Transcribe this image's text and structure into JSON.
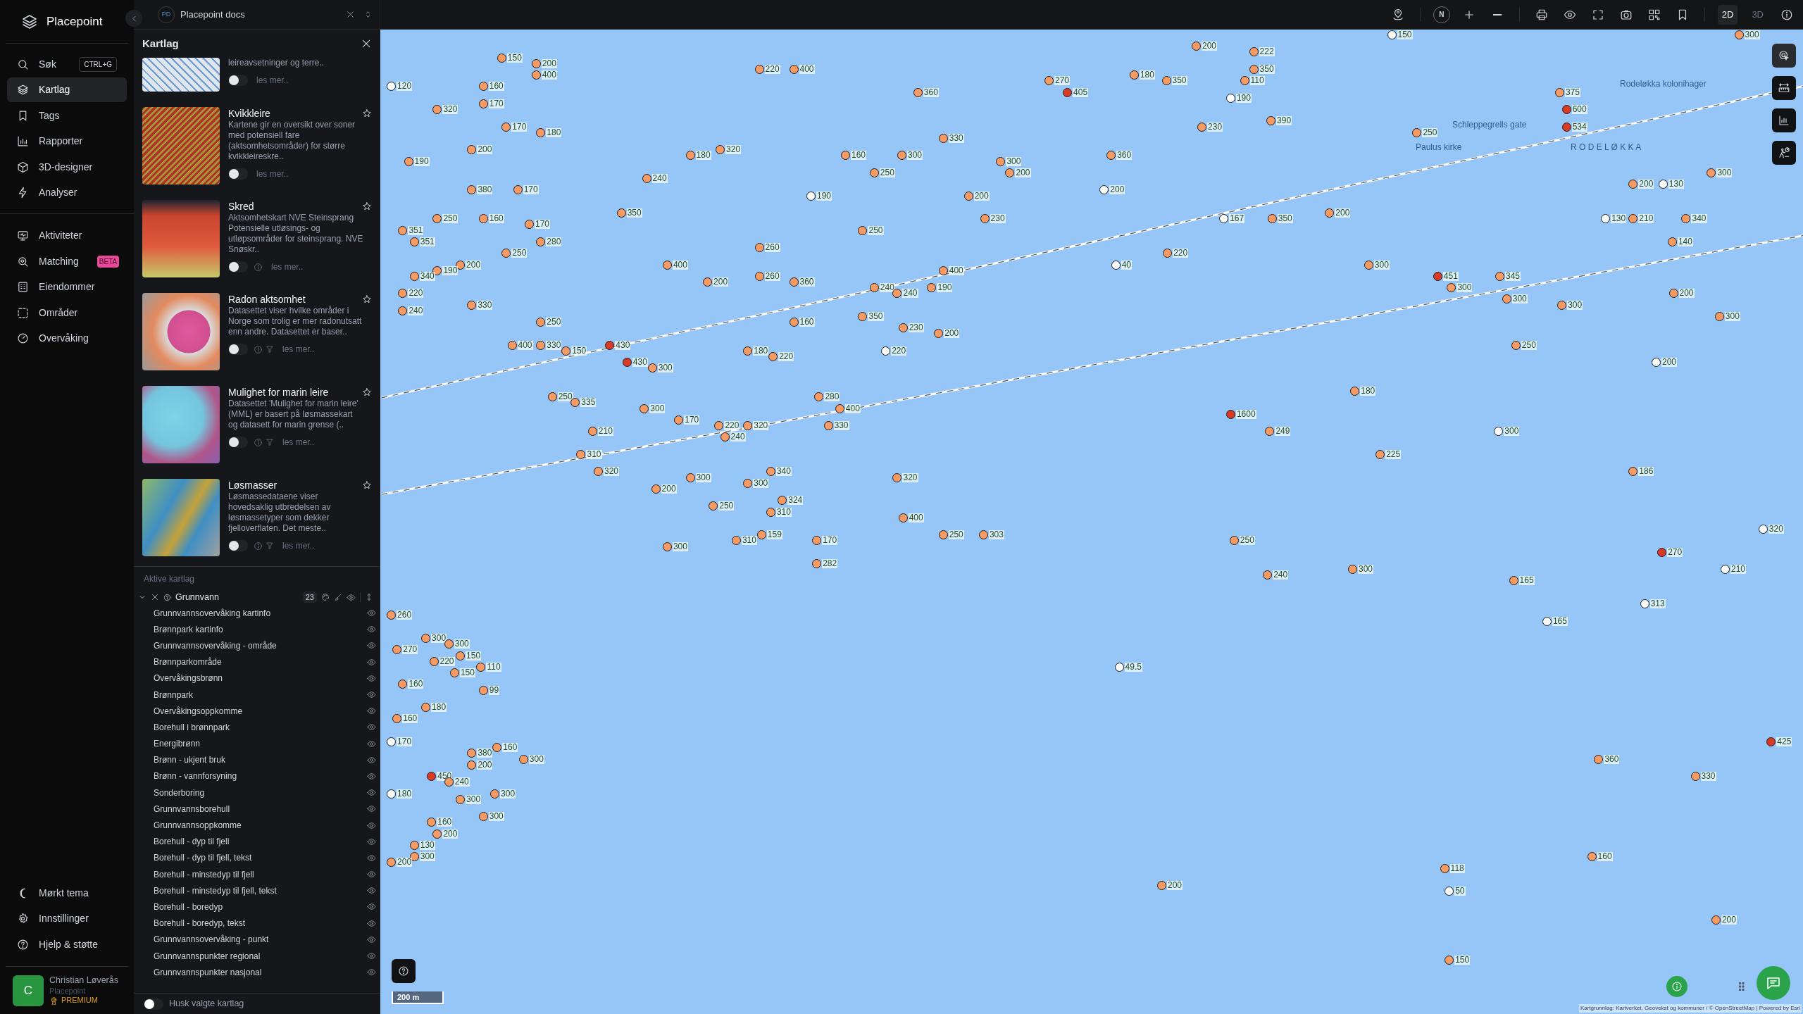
{
  "app": {
    "name": "Placepoint"
  },
  "nav": {
    "primary": [
      {
        "label": "Søk",
        "shortcut": "CTRL+G",
        "selected": false
      },
      {
        "label": "Kartlag",
        "selected": true
      },
      {
        "label": "Tags",
        "selected": false
      },
      {
        "label": "Rapporter",
        "selected": false
      },
      {
        "label": "3D-designer",
        "selected": false
      },
      {
        "label": "Analyser",
        "selected": false
      }
    ],
    "secondary": [
      {
        "label": "Aktiviteter",
        "selected": false
      },
      {
        "label": "Matching",
        "badge": "BETA",
        "selected": false
      },
      {
        "label": "Eiendommer",
        "selected": false
      },
      {
        "label": "Områder",
        "selected": false
      },
      {
        "label": "Overvåking",
        "selected": false
      }
    ],
    "bottom": [
      {
        "label": "Mørkt tema"
      },
      {
        "label": "Innstillinger"
      },
      {
        "label": "Hjelp & støtte"
      }
    ],
    "user": {
      "initial": "C",
      "name": "Christian Løverås",
      "org": "Placepoint",
      "plan": "PREMIUM"
    }
  },
  "document_tab": {
    "badge": "PD",
    "title": "Placepoint docs"
  },
  "panel": {
    "title": "Kartlag",
    "layers": [
      {
        "description": "leireavsetninger og terre..",
        "on": false,
        "info": false,
        "filter": false,
        "more": "les mer.."
      },
      {
        "title": "Kvikkleire",
        "description": "Kartene gir en oversikt over soner med potensiell fare (aktsomhetsområder) for større kvikkleireskre..",
        "on": false,
        "info": false,
        "filter": false,
        "favorite": false,
        "more": "les mer.."
      },
      {
        "title": "Skred",
        "description": "Aktsomhetskart NVE Steinsprang Potensielle utløsings- og utløpsområder for steinsprang. NVE Snøskr..",
        "on": false,
        "info": true,
        "filter": false,
        "favorite": false,
        "more": "les mer.."
      },
      {
        "title": "Radon aktsomhet",
        "description": "Datasettet viser hvilke områder i Norge som trolig er mer radonutsatt enn andre. Datasettet er baser..",
        "on": false,
        "info": true,
        "filter": true,
        "favorite": false,
        "more": "les mer.."
      },
      {
        "title": "Mulighet for marin leire",
        "description": "Datasettet 'Mulighet for marin leire' (MML) er basert på løsmassekart og datasett for marin grense (..",
        "on": false,
        "info": true,
        "filter": true,
        "favorite": false,
        "more": "les mer.."
      },
      {
        "title": "Løsmasser",
        "description": "Løsmassedataene viser hovedsaklig utbredelsen av løsmassetyper som dekker fjelloverflaten. Det meste..",
        "on": false,
        "info": true,
        "filter": true,
        "favorite": false,
        "more": "les mer.."
      }
    ],
    "active_title": "Aktive kartlag",
    "group": {
      "name": "Grunnvann",
      "count": "23",
      "expanded": true,
      "visible": true,
      "sublayers": [
        {
          "label": "Grunnvannsovervåking kartinfo",
          "visible": true
        },
        {
          "label": "Brønnpark kartinfo",
          "visible": true
        },
        {
          "label": "Grunnvannsovervåking - område",
          "visible": true
        },
        {
          "label": "Brønnparkområde",
          "visible": true
        },
        {
          "label": "Overvåkingsbrønn",
          "visible": true
        },
        {
          "label": "Brønnpark",
          "visible": true
        },
        {
          "label": "Overvåkingsoppkomme",
          "visible": true
        },
        {
          "label": "Borehull i brønnpark",
          "visible": true
        },
        {
          "label": "Energibrønn",
          "visible": true
        },
        {
          "label": "Brønn - ukjent bruk",
          "visible": true
        },
        {
          "label": "Brønn - vannforsyning",
          "visible": true
        },
        {
          "label": "Sonderboring",
          "visible": true
        },
        {
          "label": "Grunnvannsborehull",
          "visible": true
        },
        {
          "label": "Grunnvannsoppkomme",
          "visible": true
        },
        {
          "label": "Borehull - dyp til fjell",
          "visible": true
        },
        {
          "label": "Borehull - dyp til fjell, tekst",
          "visible": true
        },
        {
          "label": "Borehull - minstedyp til fjell",
          "visible": true
        },
        {
          "label": "Borehull - minstedyp til fjell, tekst",
          "visible": true
        },
        {
          "label": "Borehull - boredyp",
          "visible": true
        },
        {
          "label": "Borehull - boredyp, tekst",
          "visible": true
        },
        {
          "label": "Grunnvannsovervåking - punkt",
          "visible": true
        },
        {
          "label": "Grunnvannspunkter regional",
          "visible": true
        },
        {
          "label": "Grunnvannspunkter nasjonal",
          "visible": true
        }
      ]
    },
    "remember": {
      "label": "Husk valgte kartlag",
      "on": false
    }
  },
  "toolbar": {
    "compass": "N",
    "views": [
      {
        "label": "2D",
        "selected": true
      },
      {
        "label": "3D",
        "selected": false
      }
    ]
  },
  "map": {
    "place_labels": [
      "Rodeløkka kolonihager",
      "Schleppegrells gate",
      "Paulus kirke",
      "R O D E L Ø K K A"
    ],
    "markers": [
      {
        "label": "150",
        "color": "#ffffff"
      },
      {
        "label": "300",
        "color": "#f79a63"
      },
      {
        "label": "200",
        "color": "#f79a63"
      },
      {
        "label": "222",
        "color": "#f79a63"
      },
      {
        "label": "150",
        "color": "#f79a63"
      },
      {
        "label": "200",
        "color": "#f79a63"
      },
      {
        "label": "220",
        "color": "#f79a63"
      },
      {
        "label": "400",
        "color": "#f79a63"
      },
      {
        "label": "350",
        "color": "#f79a63"
      },
      {
        "label": "400",
        "color": "#f79a63"
      },
      {
        "label": "180",
        "color": "#f79a63"
      },
      {
        "label": "270",
        "color": "#f79a63"
      },
      {
        "label": "350",
        "color": "#f79a63"
      },
      {
        "label": "110",
        "color": "#f79a63"
      },
      {
        "label": "120",
        "color": "#ffffff"
      },
      {
        "label": "160",
        "color": "#f79a63"
      },
      {
        "label": "360",
        "color": "#f79a63"
      },
      {
        "label": "405",
        "color": "#d93a26"
      },
      {
        "label": "375",
        "color": "#f79a63"
      },
      {
        "label": "190",
        "color": "#ffffff"
      },
      {
        "label": "170",
        "color": "#f79a63"
      },
      {
        "label": "320",
        "color": "#f79a63"
      },
      {
        "label": "600",
        "color": "#d93a26"
      },
      {
        "label": "390",
        "color": "#f79a63"
      },
      {
        "label": "170",
        "color": "#f79a63"
      },
      {
        "label": "230",
        "color": "#f79a63"
      },
      {
        "label": "534",
        "color": "#d93a26"
      },
      {
        "label": "180",
        "color": "#f79a63"
      },
      {
        "label": "250",
        "color": "#f79a63"
      },
      {
        "label": "330",
        "color": "#f79a63"
      },
      {
        "label": "200",
        "color": "#f79a63"
      },
      {
        "label": "320",
        "color": "#f79a63"
      },
      {
        "label": "180",
        "color": "#f79a63"
      },
      {
        "label": "160",
        "color": "#f79a63"
      },
      {
        "label": "300",
        "color": "#f79a63"
      },
      {
        "label": "360",
        "color": "#f79a63"
      },
      {
        "label": "190",
        "color": "#f79a63"
      },
      {
        "label": "300",
        "color": "#f79a63"
      },
      {
        "label": "250",
        "color": "#f79a63"
      },
      {
        "label": "200",
        "color": "#f79a63"
      },
      {
        "label": "300",
        "color": "#f79a63"
      },
      {
        "label": "240",
        "color": "#f79a63"
      },
      {
        "label": "200",
        "color": "#f79a63"
      },
      {
        "label": "130",
        "color": "#ffffff"
      },
      {
        "label": "380",
        "color": "#f79a63"
      },
      {
        "label": "170",
        "color": "#f79a63"
      },
      {
        "label": "200",
        "color": "#ffffff"
      },
      {
        "label": "190",
        "color": "#ffffff"
      },
      {
        "label": "200",
        "color": "#f79a63"
      },
      {
        "label": "350",
        "color": "#f79a63"
      },
      {
        "label": "200",
        "color": "#f79a63"
      },
      {
        "label": "250",
        "color": "#f79a63"
      },
      {
        "label": "160",
        "color": "#f79a63"
      },
      {
        "label": "230",
        "color": "#f79a63"
      },
      {
        "label": "167",
        "color": "#ffffff"
      },
      {
        "label": "350",
        "color": "#f79a63"
      },
      {
        "label": "130",
        "color": "#ffffff"
      },
      {
        "label": "210",
        "color": "#f79a63"
      },
      {
        "label": "340",
        "color": "#f79a63"
      },
      {
        "label": "170",
        "color": "#f79a63"
      },
      {
        "label": "351",
        "color": "#f79a63"
      },
      {
        "label": "250",
        "color": "#f79a63"
      },
      {
        "label": "351",
        "color": "#f79a63"
      },
      {
        "label": "280",
        "color": "#f79a63"
      },
      {
        "label": "140",
        "color": "#f79a63"
      },
      {
        "label": "260",
        "color": "#f79a63"
      },
      {
        "label": "250",
        "color": "#f79a63"
      },
      {
        "label": "220",
        "color": "#f79a63"
      },
      {
        "label": "200",
        "color": "#f79a63"
      },
      {
        "label": "400",
        "color": "#f79a63"
      },
      {
        "label": "40",
        "color": "#ffffff"
      },
      {
        "label": "300",
        "color": "#f79a63"
      },
      {
        "label": "190",
        "color": "#f79a63"
      },
      {
        "label": "400",
        "color": "#f79a63"
      },
      {
        "label": "340",
        "color": "#f79a63"
      },
      {
        "label": "260",
        "color": "#f79a63"
      },
      {
        "label": "451",
        "color": "#d93a26"
      },
      {
        "label": "345",
        "color": "#f79a63"
      },
      {
        "label": "200",
        "color": "#f79a63"
      },
      {
        "label": "360",
        "color": "#f79a63"
      },
      {
        "label": "240",
        "color": "#f79a63"
      },
      {
        "label": "190",
        "color": "#f79a63"
      },
      {
        "label": "300",
        "color": "#f79a63"
      },
      {
        "label": "220",
        "color": "#f79a63"
      },
      {
        "label": "240",
        "color": "#f79a63"
      },
      {
        "label": "200",
        "color": "#f79a63"
      },
      {
        "label": "300",
        "color": "#f79a63"
      },
      {
        "label": "330",
        "color": "#f79a63"
      },
      {
        "label": "300",
        "color": "#f79a63"
      },
      {
        "label": "240",
        "color": "#f79a63"
      },
      {
        "label": "350",
        "color": "#f79a63"
      },
      {
        "label": "300",
        "color": "#f79a63"
      },
      {
        "label": "250",
        "color": "#f79a63"
      },
      {
        "label": "160",
        "color": "#f79a63"
      },
      {
        "label": "230",
        "color": "#f79a63"
      },
      {
        "label": "200",
        "color": "#f79a63"
      },
      {
        "label": "400",
        "color": "#f79a63"
      },
      {
        "label": "330",
        "color": "#f79a63"
      },
      {
        "label": "430",
        "color": "#d93a26"
      },
      {
        "label": "250",
        "color": "#f79a63"
      },
      {
        "label": "150",
        "color": "#f79a63"
      },
      {
        "label": "180",
        "color": "#f79a63"
      },
      {
        "label": "220",
        "color": "#ffffff"
      },
      {
        "label": "220",
        "color": "#f79a63"
      },
      {
        "label": "430",
        "color": "#d93a26"
      },
      {
        "label": "200",
        "color": "#ffffff"
      },
      {
        "label": "300",
        "color": "#f79a63"
      },
      {
        "label": "180",
        "color": "#f79a63"
      },
      {
        "label": "250",
        "color": "#f79a63"
      },
      {
        "label": "280",
        "color": "#f79a63"
      },
      {
        "label": "335",
        "color": "#f79a63"
      },
      {
        "label": "300",
        "color": "#f79a63"
      },
      {
        "label": "400",
        "color": "#f79a63"
      },
      {
        "label": "1600",
        "color": "#d93a26"
      },
      {
        "label": "170",
        "color": "#f79a63"
      },
      {
        "label": "220",
        "color": "#f79a63"
      },
      {
        "label": "320",
        "color": "#f79a63"
      },
      {
        "label": "330",
        "color": "#f79a63"
      },
      {
        "label": "210",
        "color": "#f79a63"
      },
      {
        "label": "249",
        "color": "#f79a63"
      },
      {
        "label": "300",
        "color": "#ffffff"
      },
      {
        "label": "240",
        "color": "#f79a63"
      },
      {
        "label": "310",
        "color": "#f79a63"
      },
      {
        "label": "225",
        "color": "#f79a63"
      },
      {
        "label": "320",
        "color": "#f79a63"
      },
      {
        "label": "340",
        "color": "#f79a63"
      },
      {
        "label": "186",
        "color": "#f79a63"
      },
      {
        "label": "300",
        "color": "#f79a63"
      },
      {
        "label": "320",
        "color": "#f79a63"
      },
      {
        "label": "300",
        "color": "#f79a63"
      },
      {
        "label": "200",
        "color": "#f79a63"
      },
      {
        "label": "324",
        "color": "#f79a63"
      },
      {
        "label": "250",
        "color": "#f79a63"
      },
      {
        "label": "310",
        "color": "#f79a63"
      },
      {
        "label": "400",
        "color": "#f79a63"
      },
      {
        "label": "320",
        "color": "#ffffff"
      },
      {
        "label": "159",
        "color": "#f79a63"
      },
      {
        "label": "250",
        "color": "#f79a63"
      },
      {
        "label": "303",
        "color": "#f79a63"
      },
      {
        "label": "310",
        "color": "#f79a63"
      },
      {
        "label": "170",
        "color": "#f79a63"
      },
      {
        "label": "250",
        "color": "#f79a63"
      },
      {
        "label": "300",
        "color": "#f79a63"
      },
      {
        "label": "270",
        "color": "#d93a26"
      },
      {
        "label": "282",
        "color": "#f79a63"
      },
      {
        "label": "300",
        "color": "#f79a63"
      },
      {
        "label": "210",
        "color": "#ffffff"
      },
      {
        "label": "240",
        "color": "#f79a63"
      },
      {
        "label": "165",
        "color": "#f79a63"
      },
      {
        "label": "313",
        "color": "#ffffff"
      },
      {
        "label": "260",
        "color": "#f79a63"
      },
      {
        "label": "165",
        "color": "#ffffff"
      },
      {
        "label": "300",
        "color": "#f79a63"
      },
      {
        "label": "300",
        "color": "#f79a63"
      },
      {
        "label": "270",
        "color": "#f79a63"
      },
      {
        "label": "150",
        "color": "#f79a63"
      },
      {
        "label": "220",
        "color": "#f79a63"
      },
      {
        "label": "110",
        "color": "#f79a63"
      },
      {
        "label": "49.5",
        "color": "#ffffff"
      },
      {
        "label": "150",
        "color": "#f79a63"
      },
      {
        "label": "160",
        "color": "#f79a63"
      },
      {
        "label": "99",
        "color": "#f79a63"
      },
      {
        "label": "180",
        "color": "#f79a63"
      },
      {
        "label": "160",
        "color": "#f79a63"
      },
      {
        "label": "170",
        "color": "#ffffff"
      },
      {
        "label": "425",
        "color": "#d93a26"
      },
      {
        "label": "160",
        "color": "#f79a63"
      },
      {
        "label": "380",
        "color": "#f79a63"
      },
      {
        "label": "300",
        "color": "#f79a63"
      },
      {
        "label": "360",
        "color": "#f79a63"
      },
      {
        "label": "200",
        "color": "#f79a63"
      },
      {
        "label": "450",
        "color": "#d93a26"
      },
      {
        "label": "330",
        "color": "#f79a63"
      },
      {
        "label": "240",
        "color": "#f79a63"
      },
      {
        "label": "180",
        "color": "#ffffff"
      },
      {
        "label": "300",
        "color": "#f79a63"
      },
      {
        "label": "300",
        "color": "#f79a63"
      },
      {
        "label": "300",
        "color": "#f79a63"
      },
      {
        "label": "160",
        "color": "#f79a63"
      },
      {
        "label": "200",
        "color": "#f79a63"
      },
      {
        "label": "130",
        "color": "#f79a63"
      },
      {
        "label": "300",
        "color": "#f79a63"
      },
      {
        "label": "160",
        "color": "#f79a63"
      },
      {
        "label": "200",
        "color": "#f79a63"
      },
      {
        "label": "118",
        "color": "#f79a63"
      },
      {
        "label": "200",
        "color": "#f79a63"
      },
      {
        "label": "50",
        "color": "#ffffff"
      },
      {
        "label": "200",
        "color": "#f79a63"
      },
      {
        "label": "150",
        "color": "#f79a63"
      }
    ],
    "scale": "200 m",
    "attribution": "Kartgrunnlag: Kartverket, Geovekst og kommuner / © OpenStreetMap | Powered by Esri"
  }
}
